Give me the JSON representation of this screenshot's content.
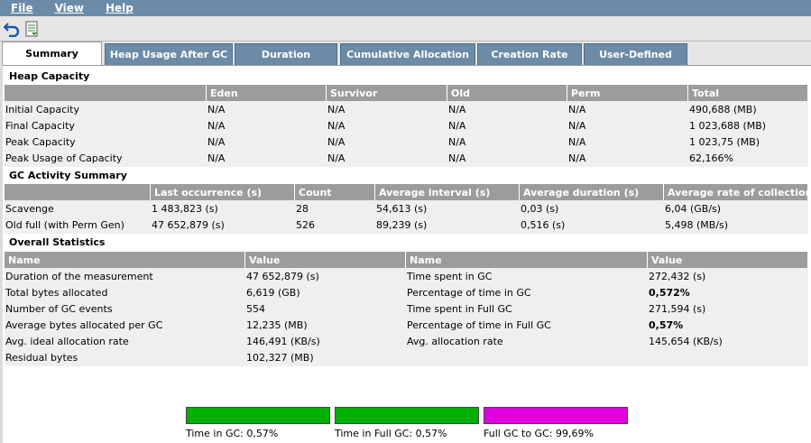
{
  "menu": {
    "file": "File",
    "view": "View",
    "help": "Help"
  },
  "toolbar": {
    "back_icon": "undo-arrow-icon",
    "export_icon": "export-document-icon"
  },
  "tabs": [
    "Summary",
    "Heap Usage After GC",
    "Duration",
    "Cumulative Allocation",
    "Creation Rate",
    "User-Defined"
  ],
  "heap": {
    "title": "Heap Capacity",
    "headers": [
      "",
      "Eden",
      "Survivor",
      "Old",
      "Perm",
      "Total"
    ],
    "rows": [
      [
        "Initial Capacity",
        "N/A",
        "N/A",
        "N/A",
        "N/A",
        "490,688 (MB)"
      ],
      [
        "Final Capacity",
        "N/A",
        "N/A",
        "N/A",
        "N/A",
        "1 023,688 (MB)"
      ],
      [
        "Peak Capacity",
        "N/A",
        "N/A",
        "N/A",
        "N/A",
        "1 023,75 (MB)"
      ],
      [
        "Peak Usage of Capacity",
        "N/A",
        "N/A",
        "N/A",
        "N/A",
        "62,166%"
      ]
    ]
  },
  "gc": {
    "title": "GC Activity Summary",
    "headers": [
      "",
      "Last occurrence (s)",
      "Count",
      "Average interval (s)",
      "Average duration (s)",
      "Average rate of collection"
    ],
    "rows": [
      [
        "Scavenge",
        "1 483,823 (s)",
        "28",
        "54,613 (s)",
        "0,03 (s)",
        "6,04 (GB/s)"
      ],
      [
        "Old full (with Perm Gen)",
        "47 652,879 (s)",
        "526",
        "89,239 (s)",
        "0,516 (s)",
        "5,498 (MB/s)"
      ]
    ]
  },
  "overall": {
    "title": "Overall Statistics",
    "headers": [
      "Name",
      "Value",
      "Name",
      "Value"
    ],
    "rows": [
      [
        "Duration of the measurement",
        "47 652,879 (s)",
        "Time spent in GC",
        "272,432 (s)"
      ],
      [
        "Total bytes allocated",
        "6,619 (GB)",
        "Percentage of time in GC",
        "0,572%"
      ],
      [
        "Number of GC events",
        "554",
        "Time spent in Full GC",
        "271,594 (s)"
      ],
      [
        "Average bytes allocated per GC",
        "12,235 (MB)",
        "Percentage of time in Full GC",
        "0,57%"
      ],
      [
        "Avg. ideal allocation rate",
        "146,491 (KB/s)",
        "Avg. allocation rate",
        "145,654 (KB/s)"
      ],
      [
        "Residual bytes",
        "102,327 (MB)",
        "",
        ""
      ]
    ]
  },
  "bars": [
    {
      "label": "Time in GC: 0,57%",
      "color": "#00b000"
    },
    {
      "label": "Time in Full GC: 0,57%",
      "color": "#00b000"
    },
    {
      "label": "Full GC to GC: 99,69%",
      "color": "#e000e0"
    }
  ]
}
